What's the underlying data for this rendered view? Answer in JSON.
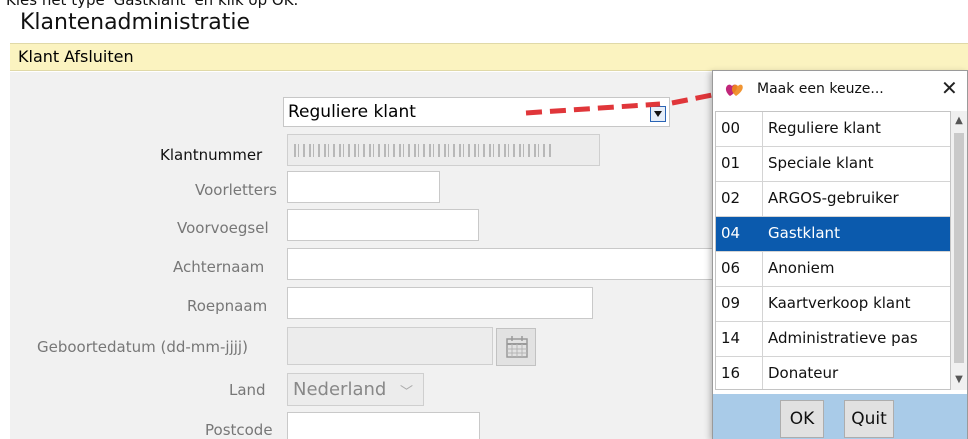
{
  "instruction": "Kies het type 'Gastklant' en klik op OK.",
  "app_title": "Klantenadministratie",
  "menu": {
    "items": [
      "Klant",
      "Afsluiten"
    ]
  },
  "form": {
    "type_select": {
      "value": "Reguliere klant"
    },
    "fields": {
      "klantnummer": {
        "label": "Klantnummer",
        "value": ""
      },
      "voorletters": {
        "label": "Voorletters",
        "value": ""
      },
      "voorvoegsel": {
        "label": "Voorvoegsel",
        "value": ""
      },
      "achternaam": {
        "label": "Achternaam",
        "value": ""
      },
      "roepnaam": {
        "label": "Roepnaam",
        "value": ""
      },
      "geboortedatum": {
        "label": "Geboortedatum (dd-mm-jjjj)",
        "value": ""
      },
      "land": {
        "label": "Land",
        "value": "Nederland"
      },
      "postcode": {
        "label": "Postcode",
        "value": ""
      }
    }
  },
  "dialog": {
    "title": "Maak een keuze...",
    "close_glyph": "✕",
    "options": [
      {
        "code": "00",
        "name": "Reguliere klant",
        "selected": false
      },
      {
        "code": "01",
        "name": "Speciale klant",
        "selected": false
      },
      {
        "code": "02",
        "name": "ARGOS-gebruiker",
        "selected": false
      },
      {
        "code": "04",
        "name": "Gastklant",
        "selected": true
      },
      {
        "code": "06",
        "name": "Anoniem",
        "selected": false
      },
      {
        "code": "09",
        "name": "Kaartverkoop klant",
        "selected": false
      },
      {
        "code": "14",
        "name": "Administratieve pas",
        "selected": false
      },
      {
        "code": "16",
        "name": "Donateur",
        "selected": false
      }
    ],
    "ok_label": "OK",
    "quit_label": "Quit"
  },
  "colors": {
    "menubar": "#fbf3c0",
    "selection": "#0b5aad",
    "dialog_footer": "#a9cbe8",
    "arrow": "#e0363a"
  },
  "icons": {
    "dialog_icon": "hearts-logo-icon",
    "calendar": "calendar-icon",
    "dropdown": "chevron-down-icon"
  }
}
